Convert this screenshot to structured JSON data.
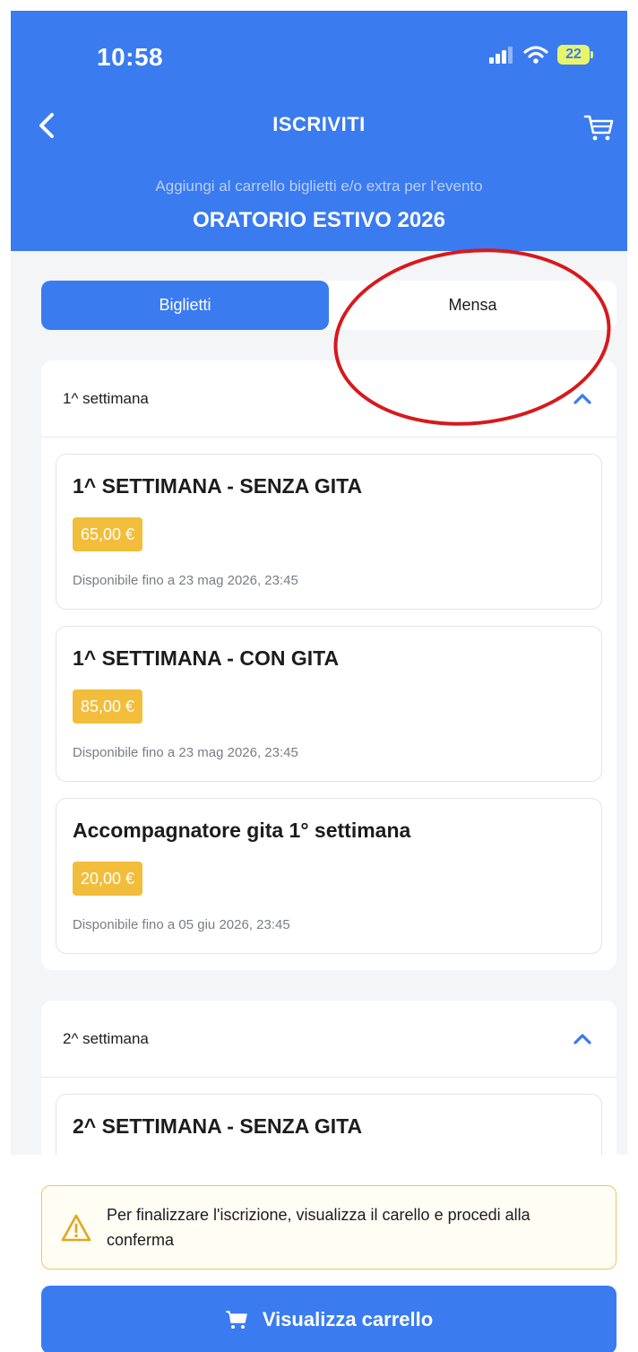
{
  "status_bar": {
    "time": "10:58",
    "battery": "22"
  },
  "header": {
    "title": "ISCRIVITI",
    "subtitle": "Aggiungi al carrello biglietti e/o extra per l'evento",
    "event_name": "ORATORIO ESTIVO 2026"
  },
  "tabs": [
    {
      "label": "Biglietti",
      "active": true
    },
    {
      "label": "Mensa",
      "active": false
    }
  ],
  "groups": [
    {
      "title": "1^ settimana",
      "expanded": true,
      "tickets": [
        {
          "name": "1^ SETTIMANA - SENZA GITA",
          "price": "65,00 €",
          "availability": "Disponibile fino a 23 mag 2026, 23:45"
        },
        {
          "name": "1^ SETTIMANA - CON GITA",
          "price": "85,00 €",
          "availability": "Disponibile fino a 23 mag 2026, 23:45"
        },
        {
          "name": "Accompagnatore gita 1° settimana",
          "price": "20,00 €",
          "availability": "Disponibile fino a 05 giu 2026, 23:45"
        }
      ]
    },
    {
      "title": "2^ settimana",
      "expanded": true,
      "tickets": [
        {
          "name": "2^ SETTIMANA - SENZA GITA"
        }
      ]
    }
  ],
  "warning": {
    "text": "Per finalizzare l'iscrizione, visualizza il carello e procedi alla conferma"
  },
  "cart_button": {
    "label": "Visualizza carrello"
  },
  "colors": {
    "primary": "#3a7bf0",
    "price_badge": "#f3bd3c",
    "warning_border": "#ecc860",
    "annotation": "#d7191c"
  }
}
